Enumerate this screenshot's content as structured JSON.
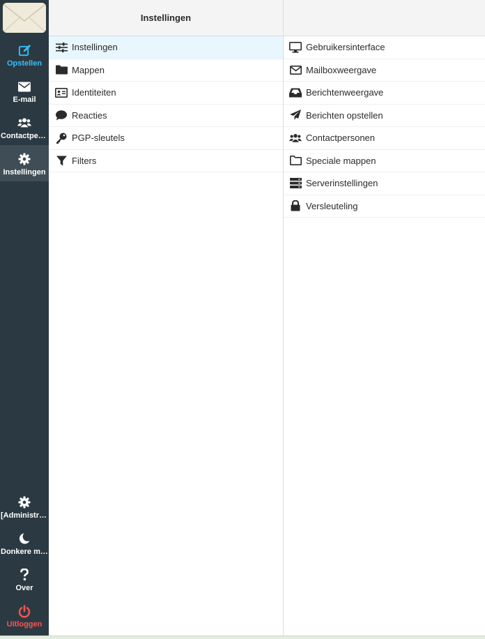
{
  "nav": {
    "items": [
      {
        "label": "Opstellen",
        "icon": "compose-icon"
      },
      {
        "label": "E-mail",
        "icon": "envelope-icon"
      },
      {
        "label": "Contactpersonen",
        "icon": "users-icon"
      },
      {
        "label": "Instellingen",
        "icon": "gear-icon"
      }
    ],
    "bottom_items": [
      {
        "label": "[Administrator]",
        "icon": "gear-icon"
      },
      {
        "label": "Donkere modus",
        "icon": "moon-icon"
      },
      {
        "label": "Over",
        "icon": "question-icon"
      },
      {
        "label": "Uitloggen",
        "icon": "power-icon"
      }
    ]
  },
  "settings": {
    "title": "Instellingen",
    "items": [
      {
        "label": "Instellingen",
        "icon": "sliders-icon"
      },
      {
        "label": "Mappen",
        "icon": "folder-icon"
      },
      {
        "label": "Identiteiten",
        "icon": "id-card-icon"
      },
      {
        "label": "Reacties",
        "icon": "comment-icon"
      },
      {
        "label": "PGP-sleutels",
        "icon": "key-icon"
      },
      {
        "label": "Filters",
        "icon": "filter-icon"
      }
    ]
  },
  "sections": {
    "title": "",
    "items": [
      {
        "label": "Gebruikersinterface",
        "icon": "desktop-icon"
      },
      {
        "label": "Mailboxweergave",
        "icon": "envelope-outline-icon"
      },
      {
        "label": "Berichtenweergave",
        "icon": "inbox-icon"
      },
      {
        "label": "Berichten opstellen",
        "icon": "paper-plane-icon"
      },
      {
        "label": "Contactpersonen",
        "icon": "users-icon"
      },
      {
        "label": "Speciale mappen",
        "icon": "folder-outline-icon"
      },
      {
        "label": "Serverinstellingen",
        "icon": "server-icon"
      },
      {
        "label": "Versleuteling",
        "icon": "lock-icon"
      }
    ]
  },
  "colors": {
    "nav_bg": "#2b3a42",
    "accent": "#37beff",
    "logout": "#ff5252",
    "selected_row": "#e8f6fd"
  }
}
